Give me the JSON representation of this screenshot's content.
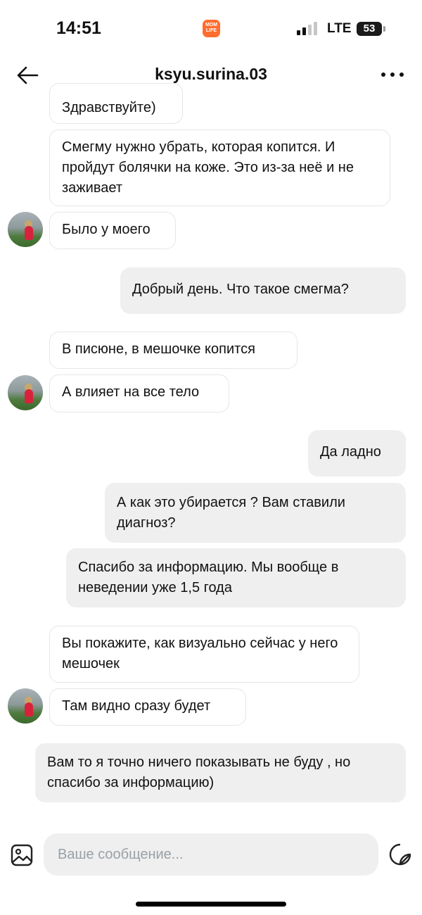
{
  "status_bar": {
    "time": "14:51",
    "app_logo_text": "MOM LIFE",
    "network": "LTE",
    "battery": "53"
  },
  "header": {
    "title": "ksyu.surina.03",
    "back_icon": "arrow-left-icon",
    "more_icon": "more-dots-icon"
  },
  "messages": [
    {
      "side": "in",
      "text": "Здравствуйте)"
    },
    {
      "side": "in",
      "text": "Смегму нужно убрать, которая копится. И пройдут болячки на коже. Это из-за неё и не заживает"
    },
    {
      "side": "in",
      "text": "Было у моего"
    },
    {
      "side": "out",
      "text": "Добрый день. Что такое смегма?"
    },
    {
      "side": "in",
      "text": "В писюне, в мешочке копится"
    },
    {
      "side": "in",
      "text": "А влияет на все тело"
    },
    {
      "side": "out",
      "text": "Да ладно"
    },
    {
      "side": "out",
      "text": "А как это убирается ? Вам ставили диагноз?"
    },
    {
      "side": "out",
      "text": "Спасибо за информацию. Мы вообще в неведении уже 1,5 года"
    },
    {
      "side": "in",
      "text": "Вы покажите, как визуально сейчас у него мешочек"
    },
    {
      "side": "in",
      "text": "Там видно сразу будет"
    },
    {
      "side": "out",
      "text": "Вам то я точно ничего показывать не буду , но спасибо за информацию)"
    }
  ],
  "composer": {
    "placeholder": "Ваше сообщение...",
    "value": "",
    "gallery_icon": "image-icon",
    "sticker_icon": "sticker-icon"
  },
  "colors": {
    "incoming_bubble": "#ffffff",
    "outgoing_bubble": "#efefef",
    "accent": "#ff6d2e"
  }
}
